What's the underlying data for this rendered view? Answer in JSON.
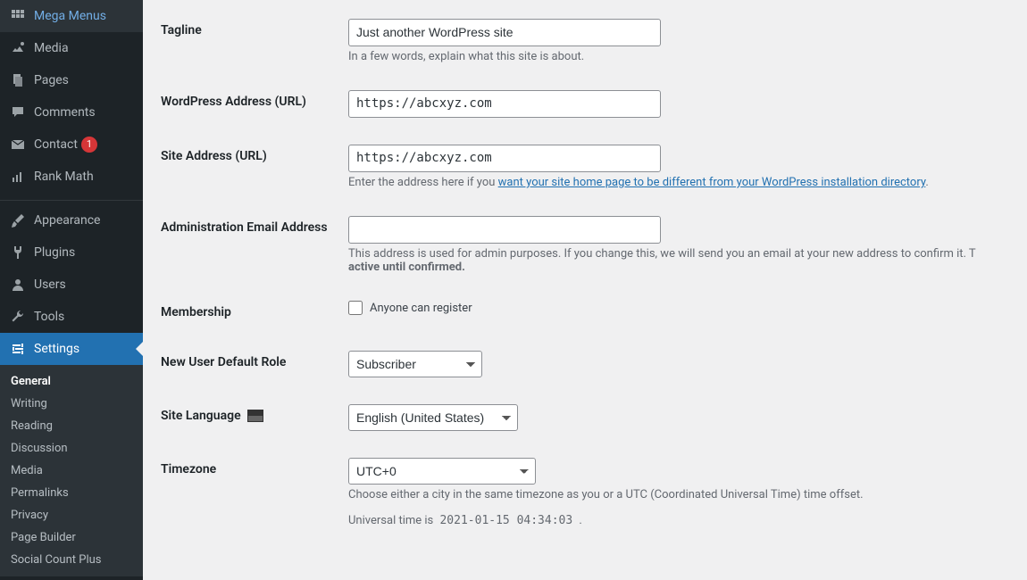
{
  "sidebar": {
    "items": [
      {
        "icon": "grid",
        "label": "Mega Menus"
      },
      {
        "icon": "media",
        "label": "Media"
      },
      {
        "icon": "page",
        "label": "Pages"
      },
      {
        "icon": "comment",
        "label": "Comments"
      },
      {
        "icon": "mail",
        "label": "Contact",
        "badge": "1"
      },
      {
        "icon": "chart",
        "label": "Rank Math"
      }
    ],
    "items2": [
      {
        "icon": "brush",
        "label": "Appearance"
      },
      {
        "icon": "plug",
        "label": "Plugins"
      },
      {
        "icon": "user",
        "label": "Users"
      },
      {
        "icon": "wrench",
        "label": "Tools"
      },
      {
        "icon": "settings",
        "label": "Settings",
        "active": true
      }
    ],
    "submenu": [
      {
        "label": "General",
        "current": true
      },
      {
        "label": "Writing"
      },
      {
        "label": "Reading"
      },
      {
        "label": "Discussion"
      },
      {
        "label": "Media"
      },
      {
        "label": "Permalinks"
      },
      {
        "label": "Privacy"
      },
      {
        "label": "Page Builder"
      },
      {
        "label": "Social Count Plus"
      }
    ]
  },
  "form": {
    "tagline": {
      "label": "Tagline",
      "value": "Just another WordPress site",
      "desc": "In a few words, explain what this site is about."
    },
    "wpurl": {
      "label": "WordPress Address (URL)",
      "value": "https://abcxyz.com"
    },
    "siteurl": {
      "label": "Site Address (URL)",
      "value": "https://abcxyz.com",
      "desc_pre": "Enter the address here if you ",
      "desc_link": "want your site home page to be different from your WordPress installation directory",
      "desc_post": "."
    },
    "admin_email": {
      "label": "Administration Email Address",
      "value": "",
      "desc_a": "This address is used for admin purposes. If you change this, we will send you an email at your new address to confirm it. T",
      "desc_b": "active until confirmed."
    },
    "membership": {
      "label": "Membership",
      "checkbox_label": "Anyone can register"
    },
    "default_role": {
      "label": "New User Default Role",
      "value": "Subscriber"
    },
    "site_lang": {
      "label": "Site Language",
      "value": "English (United States)"
    },
    "timezone": {
      "label": "Timezone",
      "value": "UTC+0",
      "desc": "Choose either a city in the same timezone as you or a UTC (Coordinated Universal Time) time offset.",
      "utc_pre": "Universal time is ",
      "utc_val": "2021-01-15 04:34:03",
      "utc_post": " ."
    }
  }
}
